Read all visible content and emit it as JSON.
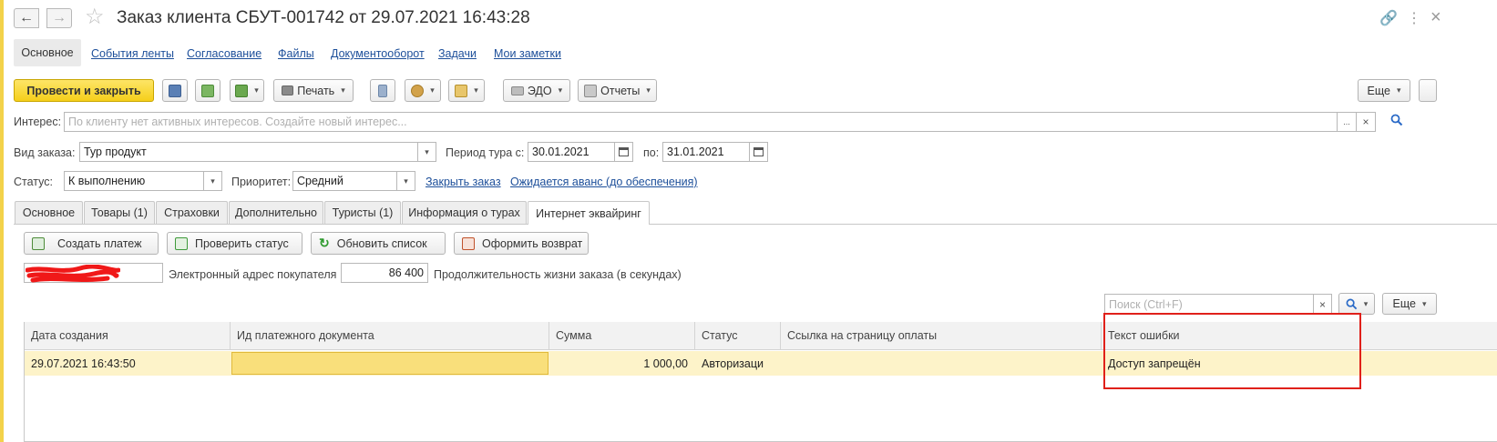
{
  "window": {
    "title": "Заказ клиента СБУТ-001742 от 29.07.2021 16:43:28",
    "back_icon": "←",
    "forward_icon": "→",
    "star_icon": "☆",
    "link_icon": "🔗",
    "more_icon": "⋮",
    "close_icon": "×"
  },
  "nav": {
    "active": "Основное",
    "links": [
      "События ленты",
      "Согласование",
      "Файлы",
      "Документооборот",
      "Задачи",
      "Мои заметки"
    ]
  },
  "toolbar": {
    "post_close": "Провести и закрыть",
    "print": "Печать",
    "edo": "ЭДО",
    "reports": "Отчеты",
    "more": "Еще"
  },
  "form": {
    "interest_label": "Интерес:",
    "interest_placeholder": "По клиенту нет активных интересов. Создайте новый интерес...",
    "order_kind_label": "Вид заказа:",
    "order_kind_value": "Тур продукт",
    "period_from_label": "Период тура с:",
    "period_from_value": "30.01.2021",
    "period_to_label": "по:",
    "period_to_value": "31.01.2021",
    "status_label": "Статус:",
    "status_value": "К выполнению",
    "priority_label": "Приоритет:",
    "priority_value": "Средний",
    "close_order_link": "Закрыть заказ",
    "advance_link": "Ожидается аванс (до обеспечения)",
    "ellipsis": "...",
    "clear": "×",
    "caret": "▾"
  },
  "tabs": [
    "Основное",
    "Товары (1)",
    "Страховки",
    "Дополнительно",
    "Туристы (1)",
    "Информация о турах",
    "Интернет эквайринг"
  ],
  "acquiring": {
    "buttons": [
      "Создать платеж",
      "Проверить статус",
      "Обновить список",
      "Оформить возврат"
    ],
    "email_label": "Электронный адрес покупателя",
    "lifetime_value": "86 400",
    "lifetime_label": "Продолжительность жизни заказа (в секундах)",
    "search_placeholder": "Поиск (Ctrl+F)",
    "more": "Еще"
  },
  "table": {
    "columns": [
      "Дата создания",
      "Ид платежного документа",
      "Сумма",
      "Статус",
      "Ссылка на страницу оплаты",
      "Текст ошибки"
    ],
    "rows": [
      [
        "29.07.2021 16:43:50",
        "",
        "1 000,00",
        "Авторизаци",
        "",
        "Доступ запрещён"
      ]
    ]
  }
}
